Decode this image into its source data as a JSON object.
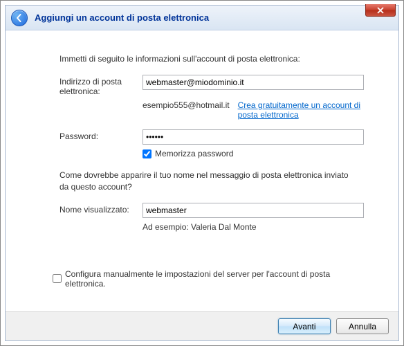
{
  "header": {
    "title": "Aggiungi un account di posta elettronica"
  },
  "intro": "Immetti di seguito le informazioni sull'account di posta elettronica:",
  "email": {
    "label": "Indirizzo di posta elettronica:",
    "value": "webmaster@miodominio.it",
    "example": "esempio555@hotmail.it",
    "link": "Crea gratuitamente un account di posta elettronica"
  },
  "password": {
    "label": "Password:",
    "value": "••••••",
    "remember_label": "Memorizza password"
  },
  "display_name": {
    "question": "Come dovrebbe apparire il tuo nome nel messaggio di posta elettronica inviato da questo account?",
    "label": "Nome visualizzato:",
    "value": "webmaster",
    "example": "Ad esempio: Valeria Dal Monte"
  },
  "manual": {
    "label": "Configura manualmente le impostazioni del server per l'account di posta elettronica."
  },
  "footer": {
    "next": "Avanti",
    "cancel": "Annulla"
  }
}
